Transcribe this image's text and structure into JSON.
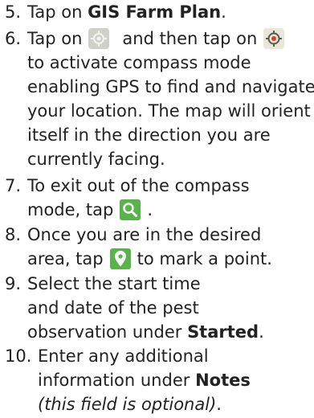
{
  "steps": [
    {
      "number": "5.",
      "lines": [
        {
          "before": "Tap on ",
          "bold": "GIS Farm Plan",
          "after": "."
        }
      ]
    },
    {
      "number": "6.",
      "line1": {
        "before": "Tap on",
        "middle": "and then tap on"
      },
      "lines": [
        "to activate compass mode",
        "enabling GPS to find and navigate",
        "your location. The map will orient",
        "itself in the direction you are",
        "currently facing."
      ],
      "icons": [
        "compass-icon",
        "compass-target-icon"
      ]
    },
    {
      "number": "7.",
      "lines": [
        "To exit out of the compass",
        "mode, tap"
      ],
      "after_icon": ".",
      "icons": [
        "search-icon"
      ]
    },
    {
      "number": "8.",
      "lines": [
        "Once you are in the desired",
        "area, tap"
      ],
      "after_icon": "to mark a point.",
      "icons": [
        "map-pin-icon"
      ]
    },
    {
      "number": "9.",
      "lines": [
        "Select the start time",
        "and date of the pest",
        "observation under "
      ],
      "bold": "Started",
      "after": "."
    },
    {
      "number": "10.",
      "line1": {
        "before": "Enter any additional"
      },
      "line2": {
        "before": "information under ",
        "bold": "Notes"
      },
      "line3": {
        "italic": "(this field is optional)",
        "after": "."
      }
    }
  ],
  "colors": {
    "text": "#222222",
    "icon_green": "#56b448",
    "icon_gray": "#cfd0c9"
  }
}
